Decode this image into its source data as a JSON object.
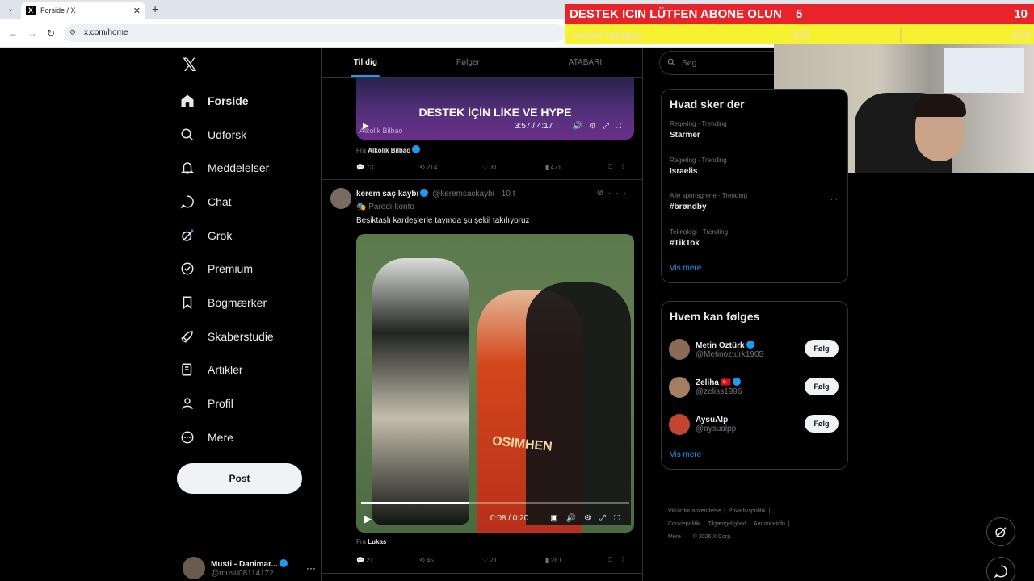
{
  "browser": {
    "tab_title": "Forside / X",
    "url": "x.com/home"
  },
  "overlay": {
    "goal_label": "DESTEK ICIN LÜTFEN ABONE OLUN",
    "goal_current": "5",
    "goal_target": "10",
    "follower_label": "hedef takipçi",
    "follower_current": "133",
    "follower_target": "200"
  },
  "sidebar": {
    "items": [
      {
        "label": "Forside",
        "icon": "home-icon"
      },
      {
        "label": "Udforsk",
        "icon": "search-icon"
      },
      {
        "label": "Meddelelser",
        "icon": "bell-icon"
      },
      {
        "label": "Chat",
        "icon": "chat-icon"
      },
      {
        "label": "Grok",
        "icon": "grok-icon"
      },
      {
        "label": "Premium",
        "icon": "premium-icon"
      },
      {
        "label": "Bogmærker",
        "icon": "bookmark-icon"
      },
      {
        "label": "Skaberstudie",
        "icon": "rocket-icon"
      },
      {
        "label": "Artikler",
        "icon": "article-icon"
      },
      {
        "label": "Profil",
        "icon": "person-icon"
      },
      {
        "label": "Mere",
        "icon": "more-circle-icon"
      }
    ],
    "post_label": "Post",
    "account_name": "Musti - Danimar...",
    "account_handle": "@musti08114172"
  },
  "timeline": {
    "tabs": [
      "Til dig",
      "Følger",
      "ATABARI"
    ],
    "video1": {
      "overlay_text": "DESTEK İÇİN LİKE VE HYPE",
      "caption": "Alkolik Bilbao",
      "time": "3:57 / 4:17",
      "from_prefix": "Fra",
      "from_name": "Alkolik Bilbao"
    },
    "actions1": {
      "replies": "73",
      "reposts": "214",
      "likes": "31",
      "views": "471"
    },
    "tweet2": {
      "name": "kerem saç kaybı",
      "handle_time": "@keremsackaybi · 10 t",
      "sub": "Parodi-konto",
      "text": "Beşiktaşlı kardeşlerle taymda şu şekil takılıyoruz",
      "video_tag": "OSIMHEN",
      "time": "0:08 / 0:20",
      "progress": 0.4,
      "from_prefix": "Fra",
      "from_name": "Lukas"
    },
    "actions2": {
      "replies": "21",
      "reposts": "45",
      "likes": "21",
      "views": "28 t"
    }
  },
  "right": {
    "search_placeholder": "Søg",
    "trends_title": "Hvad sker der",
    "trends": [
      {
        "category": "Regering · Trending",
        "name": "Starmer"
      },
      {
        "category": "Regering · Trending",
        "name": "Israelis"
      },
      {
        "category": "Alle sportsgrene · Trending",
        "name": "#brøndby"
      },
      {
        "category": "Teknologi · Trending",
        "name": "#TikTok"
      }
    ],
    "trends_more": "Vis mere",
    "follow_title": "Hvem kan følges",
    "follow": [
      {
        "name": "Metin Öztürk",
        "handle": "@Metinozturk1905",
        "btn": "Følg",
        "color": "#8a6b55"
      },
      {
        "name": "Zeliha 🇹🇷",
        "handle": "@zeliss1996",
        "btn": "Følg",
        "color": "#a57e5f"
      },
      {
        "name": "AysuAlp",
        "handle": "@aysualpp",
        "btn": "Følg",
        "color": "#c2462f"
      }
    ],
    "follow_more": "Vis mere",
    "footer": {
      "terms": "Vilkår for anvendelse",
      "privacy": "Privatlivspolitik",
      "cookies": "Cookiepolitik",
      "accessibility": "Tilgængelighed",
      "ads": "Annonceinfo",
      "more": "Mere ···",
      "copyright": "© 2026 X Corp."
    }
  }
}
